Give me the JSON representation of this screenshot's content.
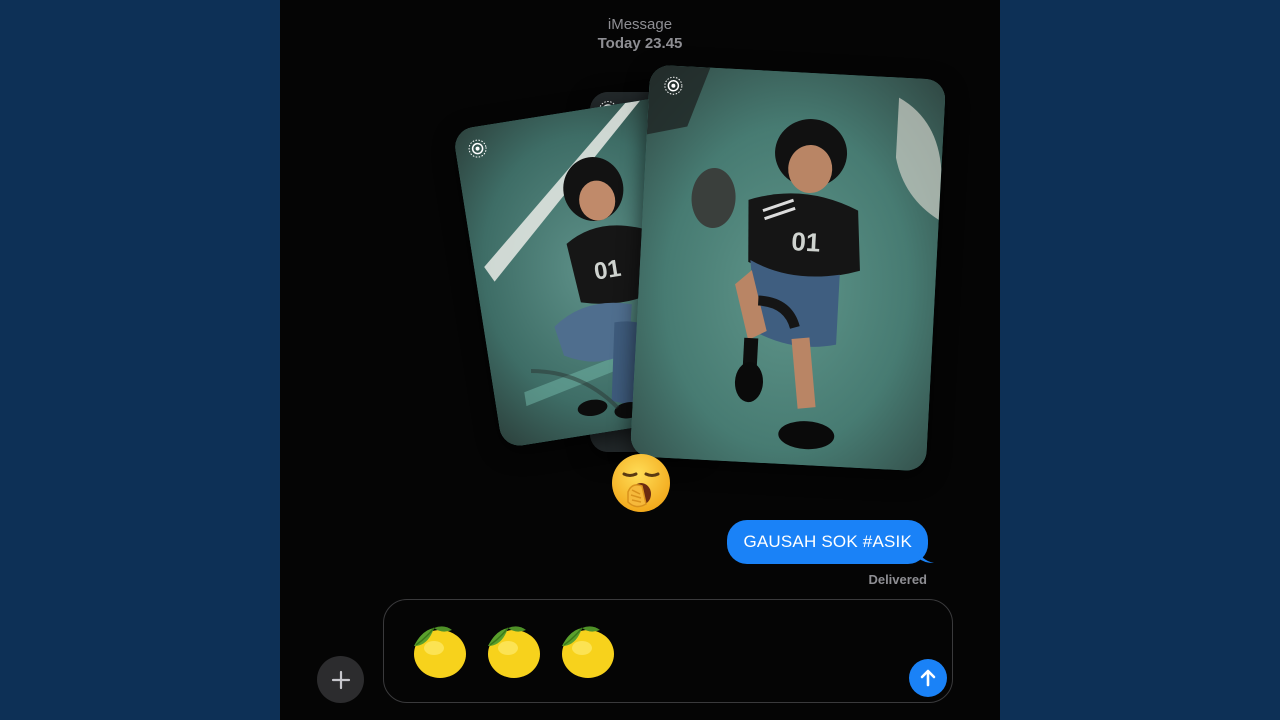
{
  "header": {
    "service": "iMessage",
    "timestamp": "Today 23.45"
  },
  "attachments": {
    "photos": [
      {
        "name": "photo-back",
        "live": true
      },
      {
        "name": "photo-left",
        "live": true
      },
      {
        "name": "photo-right",
        "live": true
      }
    ]
  },
  "reaction": {
    "emoji": "🥱",
    "icon": "yawning-face-icon"
  },
  "message": {
    "text": "GAUSAH SOK #ASIK",
    "status": "Delivered",
    "color": "#1a82f7"
  },
  "composer": {
    "value": "🍋🍋🍋",
    "emoji_icons": [
      "lemon-icon",
      "lemon-icon",
      "lemon-icon"
    ],
    "plus_icon": "plus-icon",
    "send_icon": "arrow-up-icon"
  },
  "colors": {
    "background": "#0d3056",
    "screen": "#050505",
    "accent": "#1a82f7"
  }
}
